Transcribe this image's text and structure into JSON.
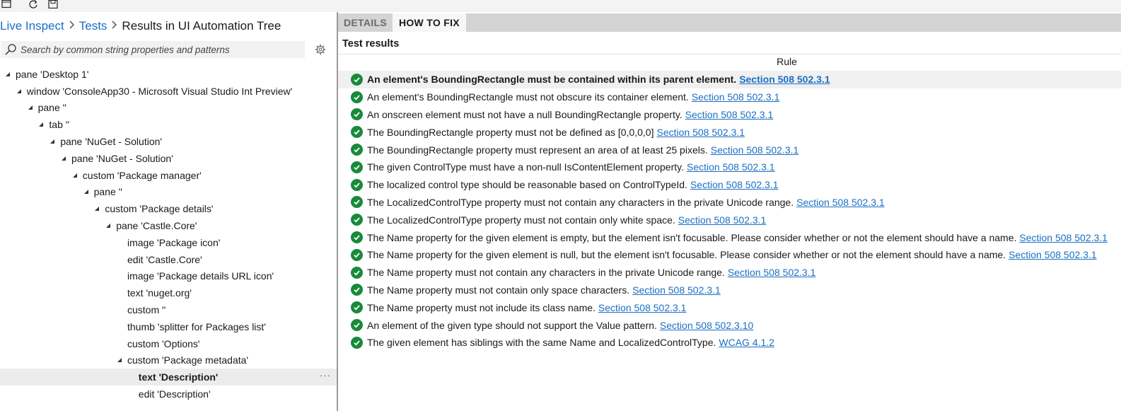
{
  "toolbar": {
    "icons": [
      "window-icon",
      "refresh-icon",
      "save-icon"
    ]
  },
  "breadcrumb": {
    "items": [
      "Live Inspect",
      "Tests"
    ],
    "current": "Results in UI Automation Tree"
  },
  "search": {
    "placeholder": "Search by common string properties and patterns",
    "value": ""
  },
  "tree": {
    "nodes": [
      {
        "label": "pane 'Desktop 1'",
        "depth": 0,
        "expanded": true
      },
      {
        "label": "window 'ConsoleApp30 - Microsoft Visual Studio Int Preview'",
        "depth": 1,
        "expanded": true
      },
      {
        "label": "pane ''",
        "depth": 2,
        "expanded": true
      },
      {
        "label": "tab ''",
        "depth": 3,
        "expanded": true
      },
      {
        "label": "pane 'NuGet - Solution'",
        "depth": 4,
        "expanded": true
      },
      {
        "label": "pane 'NuGet - Solution'",
        "depth": 5,
        "expanded": true
      },
      {
        "label": "custom 'Package manager'",
        "depth": 6,
        "expanded": true
      },
      {
        "label": "pane ''",
        "depth": 7,
        "expanded": true
      },
      {
        "label": "custom 'Package details'",
        "depth": 8,
        "expanded": true
      },
      {
        "label": "pane 'Castle.Core'",
        "depth": 9,
        "expanded": true
      },
      {
        "label": "image 'Package icon'",
        "depth": 10,
        "expanded": false
      },
      {
        "label": "edit 'Castle.Core'",
        "depth": 10,
        "expanded": false
      },
      {
        "label": "image 'Package details URL icon'",
        "depth": 10,
        "expanded": false
      },
      {
        "label": "text 'nuget.org'",
        "depth": 10,
        "expanded": false
      },
      {
        "label": "custom ''",
        "depth": 10,
        "expanded": false
      },
      {
        "label": "thumb 'splitter for Packages list'",
        "depth": 10,
        "expanded": false
      },
      {
        "label": "custom 'Options'",
        "depth": 10,
        "expanded": false
      },
      {
        "label": "custom 'Package metadata'",
        "depth": 10,
        "expanded": true
      },
      {
        "label": "text 'Description'",
        "depth": 11,
        "expanded": false,
        "selected": true
      },
      {
        "label": "edit 'Description'",
        "depth": 11,
        "expanded": false
      }
    ],
    "more_label": "···"
  },
  "tabs": [
    {
      "label": "DETAILS",
      "active": false
    },
    {
      "label": "HOW TO FIX",
      "active": true
    }
  ],
  "results": {
    "title": "Test results",
    "column_header": "Rule",
    "status_color": "#188a3a",
    "link_color": "#1a6fc4",
    "rows": [
      {
        "text": "An element's BoundingRectangle must be contained within its parent element.",
        "link": "Section 508 502.3.1",
        "highlight": true
      },
      {
        "text": "An element's BoundingRectangle must not obscure its container element.",
        "link": "Section 508 502.3.1"
      },
      {
        "text": "An onscreen element must not have a null BoundingRectangle property.",
        "link": "Section 508 502.3.1"
      },
      {
        "text": "The BoundingRectangle property must not be defined as [0,0,0,0]",
        "link": "Section 508 502.3.1"
      },
      {
        "text": "The BoundingRectangle property must represent an area of at least 25 pixels.",
        "link": "Section 508 502.3.1"
      },
      {
        "text": "The given ControlType must have a non-null IsContentElement property.",
        "link": "Section 508 502.3.1"
      },
      {
        "text": "The localized control type should be reasonable based on ControlTypeId.",
        "link": "Section 508 502.3.1"
      },
      {
        "text": "The LocalizedControlType property must not contain any characters in the private Unicode range.",
        "link": "Section 508 502.3.1"
      },
      {
        "text": "The LocalizedControlType property must not contain only white space.",
        "link": "Section 508 502.3.1"
      },
      {
        "text": "The Name property for the given element is empty, but the element isn't focusable. Please consider whether or not the element should have a name.",
        "link": "Section 508 502.3.1"
      },
      {
        "text": "The Name property for the given element is null, but the element isn't focusable. Please consider whether or not the element should have a name.",
        "link": "Section 508 502.3.1"
      },
      {
        "text": "The Name property must not contain any characters in the private Unicode range.",
        "link": "Section 508 502.3.1"
      },
      {
        "text": "The Name property must not contain only space characters.",
        "link": "Section 508 502.3.1"
      },
      {
        "text": "The Name property must not include its class name.",
        "link": "Section 508 502.3.1"
      },
      {
        "text": "An element of the given type should not support the Value pattern.",
        "link": "Section 508 502.3.10"
      },
      {
        "text": "The given element has siblings with the same Name and LocalizedControlType.",
        "link": "WCAG 4.1.2"
      }
    ]
  }
}
